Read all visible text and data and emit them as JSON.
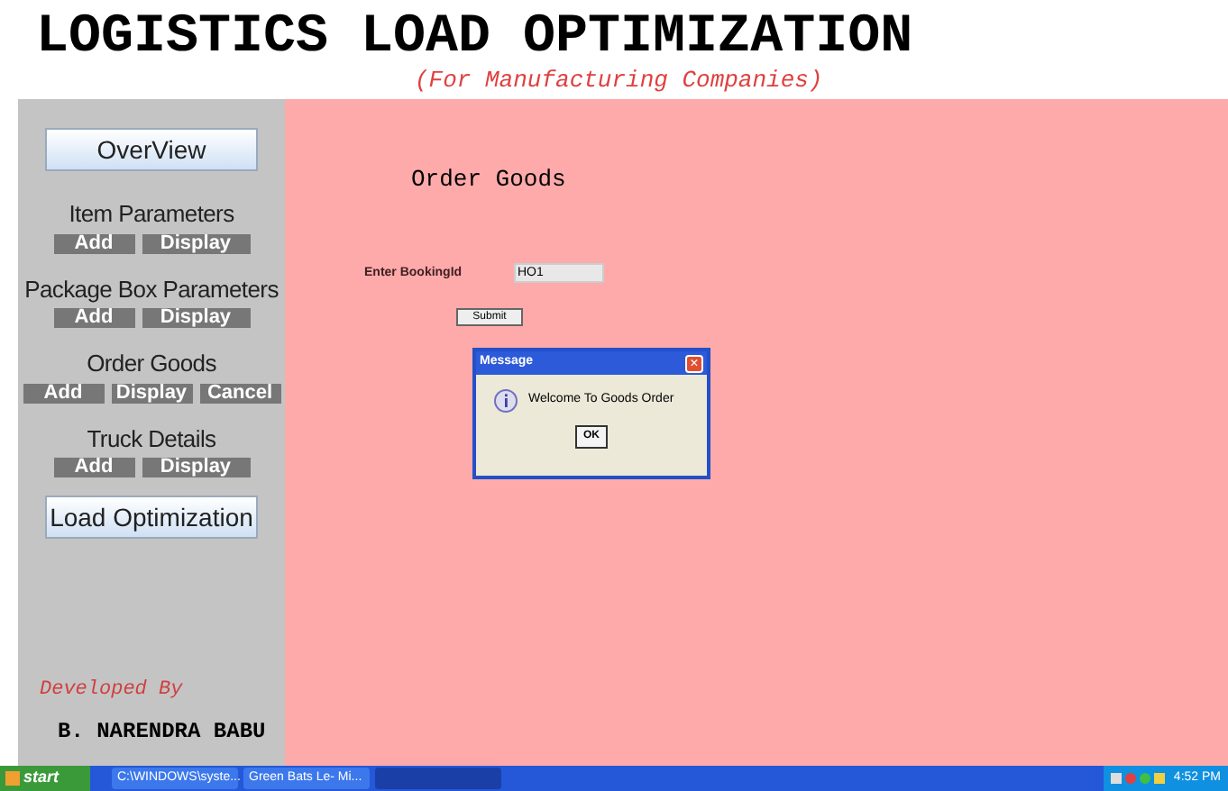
{
  "header": {
    "title": "LOGISTICS LOAD OPTIMIZATION",
    "subtitle": "(For Manufacturing Companies)"
  },
  "sidebar": {
    "sections": [
      {
        "kind": "main",
        "label": "OverView"
      },
      {
        "kind": "group",
        "label": "Item Parameters",
        "buttons": [
          "Add",
          "Display"
        ]
      },
      {
        "kind": "group",
        "label": "Package Box Parameters",
        "buttons": [
          "Add",
          "Display"
        ]
      },
      {
        "kind": "group",
        "label": "Order Goods",
        "buttons": [
          "Add",
          "Display",
          "Cancel"
        ]
      },
      {
        "kind": "group",
        "label": "Truck Details",
        "buttons": [
          "Add",
          "Display"
        ]
      },
      {
        "kind": "main",
        "label": "Load Optimization"
      }
    ],
    "credit_label": "Developed By",
    "credit_name": "B. NARENDRA BABU"
  },
  "main": {
    "heading": "Order Goods",
    "field_label": "Enter BookingId",
    "field_value": "HO1",
    "submit": "Submit"
  },
  "dialog": {
    "title": "Message",
    "close": "×",
    "message": "Welcome To Goods Order",
    "ok": "OK"
  },
  "taskbar": {
    "start": "start",
    "tasks": [
      "C:\\WINDOWS\\syste...",
      "Green Bats Le- Mi..."
    ],
    "clock": "4:52 PM"
  }
}
